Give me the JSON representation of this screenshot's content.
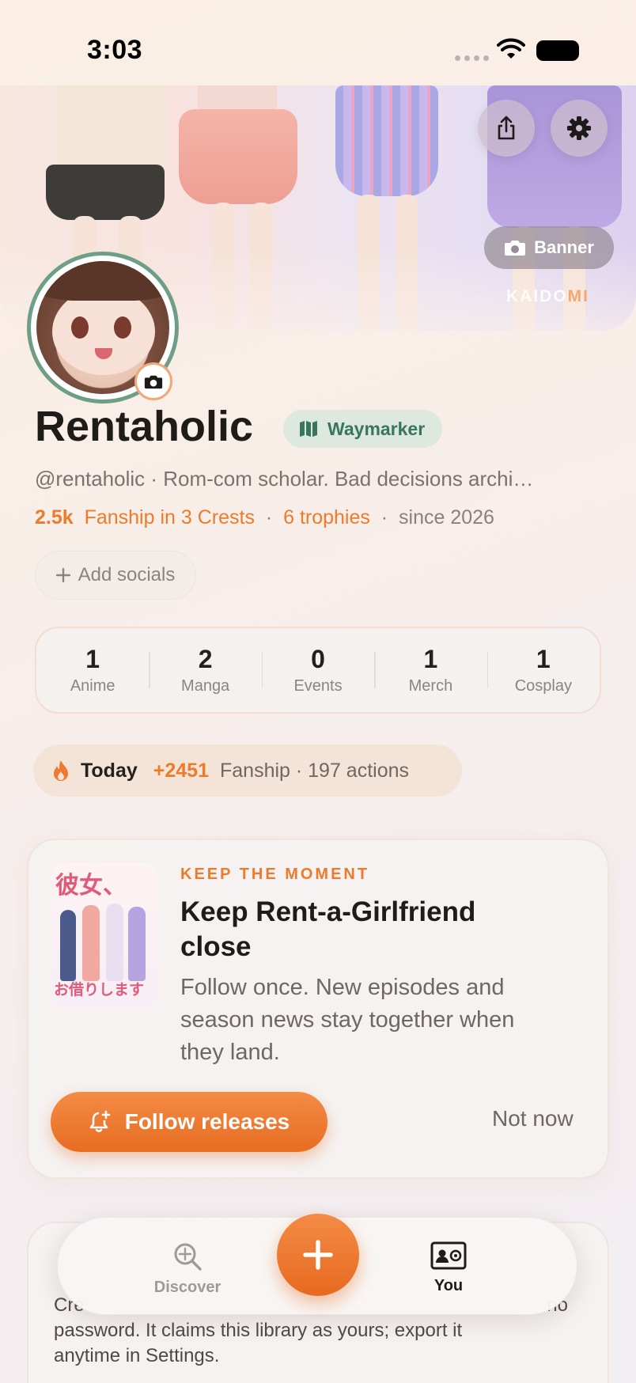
{
  "status_bar": {
    "time": "3:03"
  },
  "header": {
    "banner_button_label": "Banner",
    "brand_prefix": "KAIDO",
    "brand_suffix": "MI"
  },
  "profile": {
    "display_name": "Rentaholic",
    "badge_label": "Waymarker",
    "bio": "@rentaholic · Rom-com scholar. Bad decisions archi…",
    "fanship_count": "2.5k",
    "fanship_text": "Fanship in 3 Crests",
    "separator": "·",
    "trophies": "6 trophies",
    "since": "since 2026",
    "add_socials_label": "Add socials"
  },
  "counts": [
    {
      "value": "1",
      "label": "Anime"
    },
    {
      "value": "2",
      "label": "Manga"
    },
    {
      "value": "0",
      "label": "Events"
    },
    {
      "value": "1",
      "label": "Merch"
    },
    {
      "value": "1",
      "label": "Cosplay"
    }
  ],
  "today": {
    "label": "Today",
    "delta": "+2451",
    "rest": "Fanship · 197 actions"
  },
  "card": {
    "eyebrow": "KEEP THE MOMENT",
    "title": "Keep Rent-a-Girlfriend close",
    "body": "Follow once. New episodes and season news stay together when they land.",
    "primary_label": "Follow releases",
    "secondary_label": "Not now",
    "thumb_title_top": "彼女、",
    "thumb_title_bottom": "お借りします"
  },
  "card2": {
    "text_line_1": "Cre",
    "text_line_1_end": "no",
    "text_line_2": "password. It claims this library as yours; export it",
    "text_line_3": "anytime in Settings."
  },
  "nav": {
    "discover_label": "Discover",
    "you_label": "You"
  },
  "colors": {
    "accent": "#ee7a2b",
    "badge_green": "#3a7560",
    "text_dark": "#1f1b19",
    "text_muted": "#8a817c"
  }
}
